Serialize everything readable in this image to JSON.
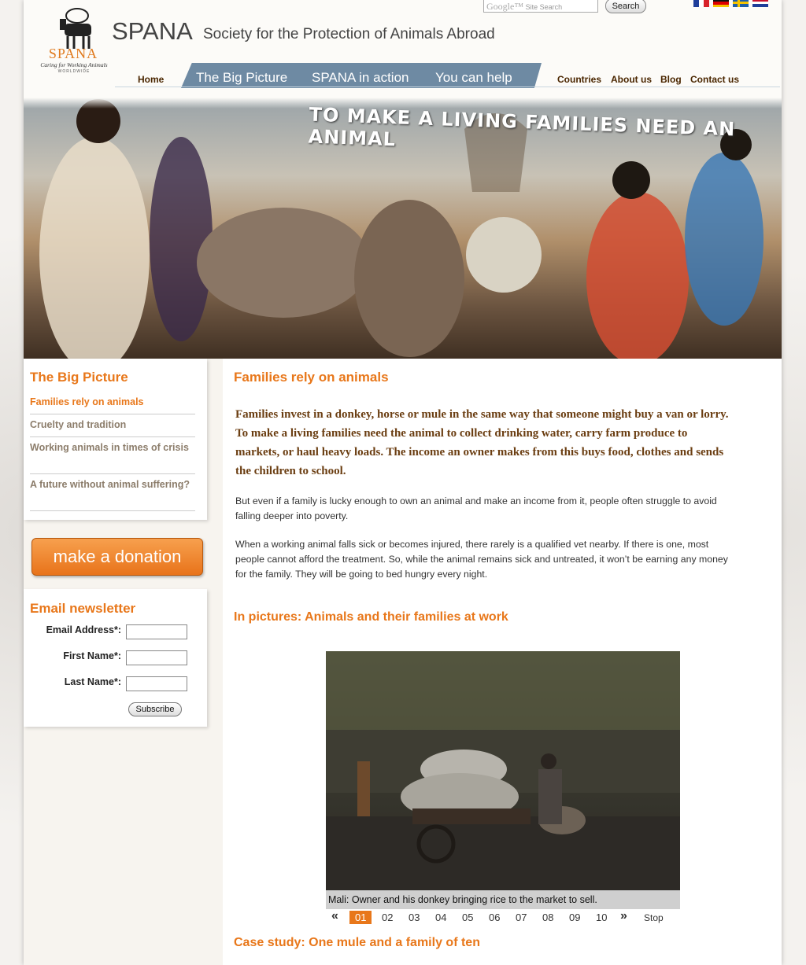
{
  "header": {
    "logo_word": "SPANA",
    "logo_tagline": "Caring for Working Animals",
    "logo_tagline2": "WORLDWIDE",
    "brand": "SPANA",
    "brand_full": "Society for the Protection of Animals Abroad",
    "search_brand": "Google™",
    "search_placeholder": "Site Search",
    "search_button": "Search"
  },
  "nav": {
    "home": "Home",
    "primary": [
      "The Big Picture",
      "SPANA in action",
      "You can help"
    ],
    "secondary": [
      "Countries",
      "About us",
      "Blog",
      "Contact us"
    ]
  },
  "hero": {
    "text": "TO MAKE A LIVING FAMILIES NEED AN ANIMAL"
  },
  "sidebar": {
    "title": "The Big Picture",
    "items": [
      "Families rely on animals",
      "Cruelty and tradition",
      "Working animals in times of crisis",
      "A future without animal suffering?"
    ],
    "donate": "make a donation"
  },
  "newsletter": {
    "title": "Email newsletter",
    "email_label": "Email Address*:",
    "first_label": "First Name*:",
    "last_label": "Last Name*:",
    "subscribe": "Subscribe"
  },
  "main": {
    "title": "Families rely on animals",
    "lead": "Families invest in a donkey, horse or mule in the same way that someone might buy a van or lorry. To make a living families need the animal to collect drinking water, carry farm produce to markets, or haul heavy loads. The income an owner makes from this buys food, clothes and sends the children to school.",
    "para1": "But even if a family is lucky enough to own an animal and make an income from it, people often struggle to avoid falling deeper into poverty.",
    "para2": "When a working animal falls sick or becomes injured, there rarely is a qualified vet nearby. If there is one, most people cannot afford the treatment. So, while the animal remains sick and untreated, it won’t be earning any money for the family. They will be going to bed hungry every night.",
    "pictures_title": "In pictures: Animals and their families at work",
    "caption": "Mali: Owner and his donkey bringing rice to the market to sell.",
    "pager": [
      "01",
      "02",
      "03",
      "04",
      "05",
      "06",
      "07",
      "08",
      "09",
      "10"
    ],
    "pager_prev": "«",
    "pager_next": "»",
    "pager_stop": "Stop",
    "case_title": "Case study: One mule and a family of ten"
  }
}
